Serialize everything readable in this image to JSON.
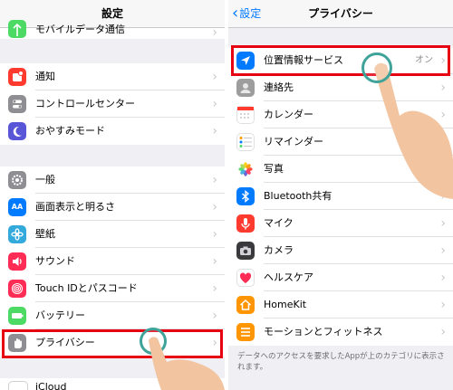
{
  "left": {
    "title": "設定",
    "top_row": {
      "label": "モバイルデータ通信"
    },
    "group1": [
      {
        "label": "通知",
        "icon": "notifications-icon",
        "color": "#ff3b30"
      },
      {
        "label": "コントロールセンター",
        "icon": "control-center-icon",
        "color": "#8e8e93"
      },
      {
        "label": "おやすみモード",
        "icon": "moon-icon",
        "color": "#5856d6"
      }
    ],
    "group2": [
      {
        "label": "一般",
        "icon": "gear-icon",
        "color": "#8e8e93"
      },
      {
        "label": "画面表示と明るさ",
        "icon": "display-brightness-icon",
        "color": "#007aff",
        "glyph": "AA"
      },
      {
        "label": "壁紙",
        "icon": "wallpaper-icon",
        "color": "#34aadc"
      },
      {
        "label": "サウンド",
        "icon": "speaker-icon",
        "color": "#ff2d55"
      },
      {
        "label": "Touch IDとパスコード",
        "icon": "fingerprint-icon",
        "color": "#ff2d55"
      },
      {
        "label": "バッテリー",
        "icon": "battery-icon",
        "color": "#4cd964"
      },
      {
        "label": "プライバシー",
        "icon": "privacy-hand-icon",
        "color": "#8e8e93"
      }
    ],
    "bottom_row": {
      "label": "iCloud"
    }
  },
  "right": {
    "title": "プライバシー",
    "back_label": "設定",
    "rows": [
      {
        "label": "位置情報サービス",
        "value": "オン",
        "icon": "location-arrow-icon",
        "color": "#007aff"
      },
      {
        "label": "連絡先",
        "icon": "contacts-icon",
        "color": "#9d9d9d"
      },
      {
        "label": "カレンダー",
        "icon": "calendar-icon",
        "color": "#ffffff"
      },
      {
        "label": "リマインダー",
        "icon": "reminders-icon",
        "color": "#ffffff"
      },
      {
        "label": "写真",
        "icon": "photos-icon",
        "color": "#ffffff"
      },
      {
        "label": "Bluetooth共有",
        "icon": "bluetooth-icon",
        "color": "#007aff"
      },
      {
        "label": "マイク",
        "icon": "microphone-icon",
        "color": "#ff3b30"
      },
      {
        "label": "カメラ",
        "icon": "camera-icon",
        "color": "#8e8e93"
      },
      {
        "label": "ヘルスケア",
        "icon": "health-heart-icon",
        "color": "#ffffff"
      },
      {
        "label": "HomeKit",
        "icon": "homekit-icon",
        "color": "#ff9500"
      },
      {
        "label": "モーションとフィットネス",
        "icon": "motion-fitness-icon",
        "color": "#ff9500"
      }
    ],
    "footer": "データへのアクセスを要求したAppが上のカテゴリに表示されます。"
  },
  "colors": {
    "highlight": "#e60012",
    "tap_ring": "#3fa39a",
    "hand": "#f2c4a0"
  }
}
